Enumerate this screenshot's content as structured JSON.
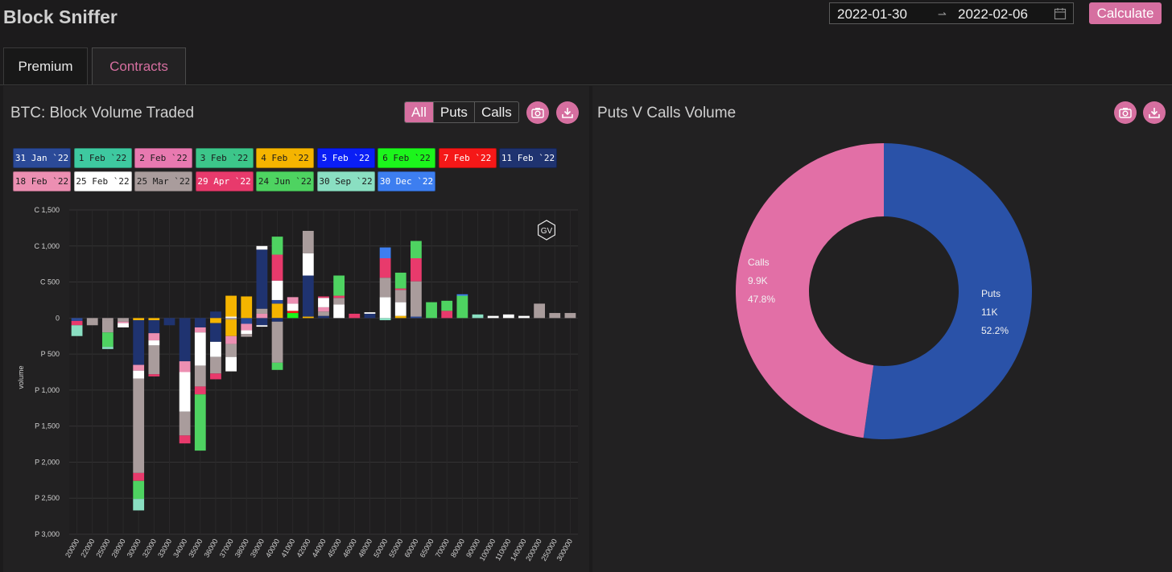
{
  "app": {
    "title": "Block Sniffer"
  },
  "header": {
    "date_start": "2022-01-30",
    "date_sep": "→",
    "date_end": "2022-02-06",
    "calculate_label": "Calculate"
  },
  "tabs": [
    {
      "label": "Premium",
      "active": false
    },
    {
      "label": "Contracts",
      "active": true
    }
  ],
  "left_panel": {
    "title": "BTC: Block Volume Traded",
    "filter": {
      "options": [
        "All",
        "Puts",
        "Calls"
      ],
      "selected": "All"
    },
    "camera_icon": "camera-icon",
    "download_icon": "download-icon"
  },
  "right_panel": {
    "title": "Puts V Calls Volume",
    "camera_icon": "camera-icon",
    "download_icon": "download-icon"
  },
  "expiries": [
    {
      "label": "31 Jan `22",
      "color": "#2b4a98",
      "text": "#ffffff"
    },
    {
      "label": "1 Feb `22",
      "color": "#3ec9a0",
      "text": "#1c1c1c"
    },
    {
      "label": "2 Feb `22",
      "color": "#e879b0",
      "text": "#1c1c1c"
    },
    {
      "label": "3 Feb `22",
      "color": "#3cc68a",
      "text": "#1c1c1c"
    },
    {
      "label": "4 Feb `22",
      "color": "#f5b400",
      "text": "#1c1c1c"
    },
    {
      "label": "5 Feb `22",
      "color": "#0a1ef5",
      "text": "#ffffff"
    },
    {
      "label": "6 Feb `22",
      "color": "#1cf51c",
      "text": "#1c1c1c"
    },
    {
      "label": "7 Feb `22",
      "color": "#f51818",
      "text": "#ffffff"
    },
    {
      "label": "11 Feb `22",
      "color": "#1f3370",
      "text": "#ffffff"
    },
    {
      "label": "18 Feb `22",
      "color": "#ec8fb2",
      "text": "#1c1c1c"
    },
    {
      "label": "25 Feb `22",
      "color": "#ffffff",
      "text": "#1c1c1c"
    },
    {
      "label": "25 Mar `22",
      "color": "#a99c9c",
      "text": "#1c1c1c"
    },
    {
      "label": "29 Apr `22",
      "color": "#e83a6c",
      "text": "#ffffff"
    },
    {
      "label": "24 Jun `22",
      "color": "#4ed361",
      "text": "#1c1c1c"
    },
    {
      "label": "30 Sep `22",
      "color": "#8adfc2",
      "text": "#1c1c1c"
    },
    {
      "label": "30 Dec `22",
      "color": "#3d7ef0",
      "text": "#ffffff"
    }
  ],
  "chart_data": [
    {
      "type": "bar",
      "title": "BTC: Block Volume Traded",
      "ylabel": "volume",
      "watermark": "GV",
      "yticks": [
        "C 1,500",
        "C 1,000",
        "C 500",
        "0",
        "P 500",
        "P 1,000",
        "P 1,500",
        "P 2,000",
        "P 2,500",
        "P 3,000"
      ],
      "ylim": [
        -3000,
        1500
      ],
      "categories": [
        "20000",
        "22000",
        "25000",
        "28000",
        "30000",
        "32000",
        "33000",
        "34000",
        "35000",
        "36000",
        "37000",
        "38000",
        "39000",
        "40000",
        "41000",
        "42000",
        "44000",
        "45000",
        "46000",
        "48000",
        "50000",
        "55000",
        "60000",
        "65000",
        "70000",
        "80000",
        "90000",
        "100000",
        "110000",
        "140000",
        "200000",
        "250000",
        "300000"
      ],
      "bars": [
        {
          "x": "20000",
          "stack": [
            {
              "v": -40,
              "c": "#2b4a98"
            },
            {
              "v": -60,
              "c": "#e83a6c"
            },
            {
              "v": -150,
              "c": "#8adfc2"
            }
          ]
        },
        {
          "x": "22000",
          "stack": [
            {
              "v": -100,
              "c": "#a99c9c"
            }
          ]
        },
        {
          "x": "25000",
          "stack": [
            {
              "v": -30,
              "c": "#a99c9c"
            },
            {
              "v": -170,
              "c": "#a99c9c"
            },
            {
              "v": -200,
              "c": "#4ed361"
            },
            {
              "v": -30,
              "c": "#8adfc2"
            }
          ]
        },
        {
          "x": "28000",
          "stack": [
            {
              "v": -50,
              "c": "#a99c9c"
            },
            {
              "v": -20,
              "c": "#ec8fb2"
            },
            {
              "v": -60,
              "c": "#ffffff"
            }
          ]
        },
        {
          "x": "30000",
          "stack": [
            {
              "v": -30,
              "c": "#f5b400"
            },
            {
              "v": -620,
              "c": "#1f3370"
            },
            {
              "v": -80,
              "c": "#ec8fb2"
            },
            {
              "v": -110,
              "c": "#ffffff"
            },
            {
              "v": -1310,
              "c": "#a99c9c"
            },
            {
              "v": -110,
              "c": "#e83a6c"
            },
            {
              "v": -250,
              "c": "#4ed361"
            },
            {
              "v": -160,
              "c": "#8adfc2"
            }
          ]
        },
        {
          "x": "32000",
          "stack": [
            {
              "v": -30,
              "c": "#f5b400"
            },
            {
              "v": -180,
              "c": "#1f3370"
            },
            {
              "v": -100,
              "c": "#ec8fb2"
            },
            {
              "v": -70,
              "c": "#ffffff"
            },
            {
              "v": -400,
              "c": "#a99c9c"
            },
            {
              "v": -30,
              "c": "#e83a6c"
            }
          ]
        },
        {
          "x": "33000",
          "stack": [
            {
              "v": -100,
              "c": "#1f3370"
            }
          ]
        },
        {
          "x": "34000",
          "stack": [
            {
              "v": -600,
              "c": "#1f3370"
            },
            {
              "v": -150,
              "c": "#ec8fb2"
            },
            {
              "v": -550,
              "c": "#ffffff"
            },
            {
              "v": -330,
              "c": "#a99c9c"
            },
            {
              "v": -110,
              "c": "#e83a6c"
            }
          ]
        },
        {
          "x": "35000",
          "stack": [
            {
              "v": -130,
              "c": "#1f3370"
            },
            {
              "v": -70,
              "c": "#ec8fb2"
            },
            {
              "v": -460,
              "c": "#ffffff"
            },
            {
              "v": -290,
              "c": "#a99c9c"
            },
            {
              "v": -110,
              "c": "#e83a6c"
            },
            {
              "v": -780,
              "c": "#4ed361"
            }
          ]
        },
        {
          "x": "36000",
          "stack": [
            {
              "v": 90,
              "c": "#1f3370"
            },
            {
              "v": -70,
              "c": "#f5b400"
            },
            {
              "v": -260,
              "c": "#1f3370"
            },
            {
              "v": -210,
              "c": "#ffffff"
            },
            {
              "v": -230,
              "c": "#a99c9c"
            },
            {
              "v": -80,
              "c": "#e83a6c"
            }
          ]
        },
        {
          "x": "37000",
          "stack": [
            {
              "v": 20,
              "c": "#ffffff"
            },
            {
              "v": -20,
              "c": "#a99c9c"
            },
            {
              "v": 290,
              "c": "#f5b400"
            },
            {
              "v": -230,
              "c": "#f5b400"
            },
            {
              "v": -110,
              "c": "#ec8fb2"
            },
            {
              "v": -180,
              "c": "#a99c9c"
            },
            {
              "v": -200,
              "c": "#ffffff"
            }
          ]
        },
        {
          "x": "38000",
          "stack": [
            {
              "v": -80,
              "c": "#2b4a98"
            },
            {
              "v": 300,
              "c": "#f5b400"
            },
            {
              "v": -90,
              "c": "#ec8fb2"
            },
            {
              "v": -50,
              "c": "#ffffff"
            },
            {
              "v": -40,
              "c": "#a99c9c"
            }
          ]
        },
        {
          "x": "39000",
          "stack": [
            {
              "v": -100,
              "c": "#1f3370"
            },
            {
              "v": -20,
              "c": "#ffffff"
            },
            {
              "v": 60,
              "c": "#ec8fb2"
            },
            {
              "v": 70,
              "c": "#a99c9c"
            },
            {
              "v": 820,
              "c": "#1f3370"
            },
            {
              "v": 50,
              "c": "#ffffff"
            }
          ]
        },
        {
          "x": "40000",
          "stack": [
            {
              "v": 200,
              "c": "#f5b400"
            },
            {
              "v": 50,
              "c": "#2b4a98"
            },
            {
              "v": 270,
              "c": "#ffffff"
            },
            {
              "v": 360,
              "c": "#e83a6c"
            },
            {
              "v": 250,
              "c": "#4ed361"
            },
            {
              "v": -50,
              "c": "#1f3370"
            },
            {
              "v": -570,
              "c": "#a99c9c"
            },
            {
              "v": -100,
              "c": "#4ed361"
            }
          ]
        },
        {
          "x": "41000",
          "stack": [
            {
              "v": 70,
              "c": "#1cf51c"
            },
            {
              "v": 30,
              "c": "#f51818"
            },
            {
              "v": 100,
              "c": "#ffffff"
            },
            {
              "v": 90,
              "c": "#ec8fb2"
            }
          ]
        },
        {
          "x": "42000",
          "stack": [
            {
              "v": 20,
              "c": "#f5b400"
            },
            {
              "v": 570,
              "c": "#1f3370"
            },
            {
              "v": 310,
              "c": "#ffffff"
            },
            {
              "v": 310,
              "c": "#a99c9c"
            }
          ]
        },
        {
          "x": "44000",
          "stack": [
            {
              "v": 30,
              "c": "#1f3370"
            },
            {
              "v": 60,
              "c": "#a99c9c"
            },
            {
              "v": 60,
              "c": "#ec8fb2"
            },
            {
              "v": 130,
              "c": "#ffffff"
            },
            {
              "v": 20,
              "c": "#e83a6c"
            }
          ]
        },
        {
          "x": "45000",
          "stack": [
            {
              "v": 190,
              "c": "#ffffff"
            },
            {
              "v": 90,
              "c": "#a99c9c"
            },
            {
              "v": 30,
              "c": "#e83a6c"
            },
            {
              "v": 280,
              "c": "#4ed361"
            }
          ]
        },
        {
          "x": "46000",
          "stack": [
            {
              "v": 60,
              "c": "#e83a6c"
            }
          ]
        },
        {
          "x": "48000",
          "stack": [
            {
              "v": 60,
              "c": "#1f3370"
            },
            {
              "v": 20,
              "c": "#ffffff"
            }
          ]
        },
        {
          "x": "50000",
          "stack": [
            {
              "v": -30,
              "c": "#8adfc2"
            },
            {
              "v": 290,
              "c": "#ffffff"
            },
            {
              "v": 270,
              "c": "#a99c9c"
            },
            {
              "v": 270,
              "c": "#e83a6c"
            },
            {
              "v": 150,
              "c": "#3d7ef0"
            }
          ]
        },
        {
          "x": "55000",
          "stack": [
            {
              "v": 30,
              "c": "#f5b400"
            },
            {
              "v": 190,
              "c": "#ffffff"
            },
            {
              "v": 170,
              "c": "#a99c9c"
            },
            {
              "v": 20,
              "c": "#e83a6c"
            },
            {
              "v": 220,
              "c": "#4ed361"
            }
          ]
        },
        {
          "x": "60000",
          "stack": [
            {
              "v": 20,
              "c": "#2b4a98"
            },
            {
              "v": 490,
              "c": "#a99c9c"
            },
            {
              "v": 320,
              "c": "#e83a6c"
            },
            {
              "v": 240,
              "c": "#4ed361"
            }
          ]
        },
        {
          "x": "65000",
          "stack": [
            {
              "v": 220,
              "c": "#4ed361"
            }
          ]
        },
        {
          "x": "70000",
          "stack": [
            {
              "v": 100,
              "c": "#e83a6c"
            },
            {
              "v": 140,
              "c": "#4ed361"
            }
          ]
        },
        {
          "x": "80000",
          "stack": [
            {
              "v": 310,
              "c": "#4ed361"
            },
            {
              "v": 20,
              "c": "#3d7ef0"
            }
          ]
        },
        {
          "x": "90000",
          "stack": [
            {
              "v": 50,
              "c": "#8adfc2"
            }
          ]
        },
        {
          "x": "100000",
          "stack": [
            {
              "v": 30,
              "c": "#ffffff"
            }
          ]
        },
        {
          "x": "110000",
          "stack": [
            {
              "v": 50,
              "c": "#ffffff"
            }
          ]
        },
        {
          "x": "140000",
          "stack": [
            {
              "v": 30,
              "c": "#ffffff"
            }
          ]
        },
        {
          "x": "200000",
          "stack": [
            {
              "v": 200,
              "c": "#a99c9c"
            }
          ]
        },
        {
          "x": "250000",
          "stack": [
            {
              "v": 70,
              "c": "#a99c9c"
            }
          ]
        },
        {
          "x": "300000",
          "stack": [
            {
              "v": 70,
              "c": "#a99c9c"
            }
          ]
        }
      ]
    },
    {
      "type": "pie",
      "title": "Puts V Calls Volume",
      "slices": [
        {
          "name": "Puts",
          "value_label": "11K",
          "pct_label": "52.2%",
          "percent": 52.2,
          "color": "#2a52a8"
        },
        {
          "name": "Calls",
          "value_label": "9.9K",
          "pct_label": "47.8%",
          "percent": 47.8,
          "color": "#e26fa6"
        }
      ]
    }
  ]
}
